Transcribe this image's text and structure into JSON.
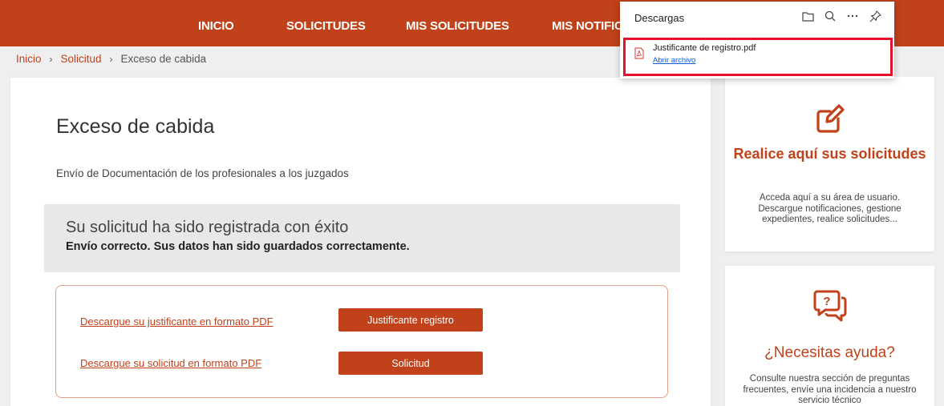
{
  "nav": {
    "items": [
      "INICIO",
      "SOLICITUDES",
      "MIS SOLICITUDES",
      "MIS NOTIFIC"
    ]
  },
  "breadcrumb": {
    "home": "Inicio",
    "solicitud": "Solicitud",
    "current": "Exceso de cabida",
    "separator": "›"
  },
  "main": {
    "title": "Exceso de cabida",
    "subtitle": "Envío de Documentación de los profesionales a los juzgados",
    "success_title": "Su solicitud ha sido registrada con éxito",
    "success_text": "Envío correcto. Sus datos han sido guardados correctamente.",
    "downloads": [
      {
        "link": "Descargue su justificante en formato PDF",
        "button": "Justificante registro"
      },
      {
        "link": "Descargue su solicitud en formato PDF",
        "button": "Solicitud"
      }
    ]
  },
  "sidebar": {
    "requests_card": {
      "icon": "edit-icon",
      "title": "Realice aquí sus solicitudes",
      "text": "Acceda aquí a su área de usuario. Descargue notificaciones, gestione expedientes, realice solicitudes..."
    },
    "help_card": {
      "icon": "help-chat-icon",
      "title": "¿Necesitas ayuda?",
      "text": "Consulte nuestra sección de preguntas frecuentes, envíe una incidencia a nuestro servicio técnico"
    }
  },
  "downloads_panel": {
    "title": "Descargas",
    "file_name": "Justificante de registro.pdf",
    "open_label": "Abrir archivo",
    "icons": [
      "folder-icon",
      "search-icon",
      "more-icon",
      "pin-icon"
    ]
  },
  "colors": {
    "brand": "#c0411a",
    "highlight": "#e8112d",
    "link_blue": "#0a5ad6"
  }
}
